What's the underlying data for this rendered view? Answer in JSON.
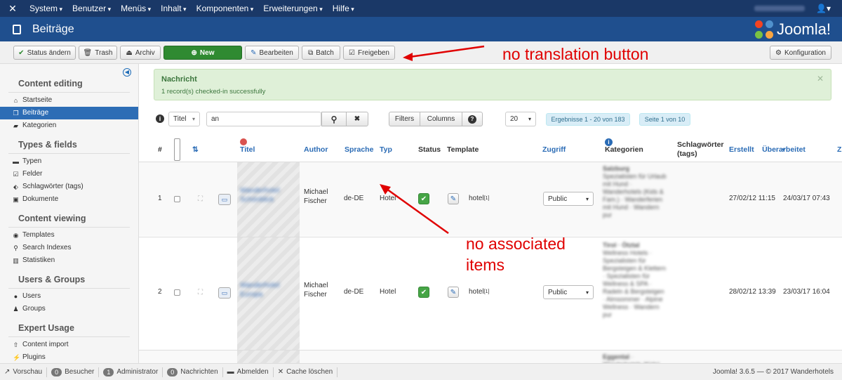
{
  "topnav": {
    "logo": "joomla-logo",
    "menus": [
      "System",
      "Benutzer",
      "Menüs",
      "Inhalt",
      "Komponenten",
      "Erweiterungen",
      "Hilfe"
    ]
  },
  "header": {
    "title": "Beiträge",
    "brand": "Joomla!"
  },
  "toolbar": {
    "status_aendern": "Status ändern",
    "trash": "Trash",
    "archiv": "Archiv",
    "new": "New",
    "bearbeiten": "Bearbeiten",
    "batch": "Batch",
    "freigeben": "Freigeben",
    "konfiguration": "Konfiguration"
  },
  "annotations": {
    "no_translation": "no translation button",
    "no_associated_1": "no associated",
    "no_associated_2": "items",
    "ghost": "no associated items",
    "color": "#e00000"
  },
  "sidebar": {
    "sections": [
      {
        "title": "Content editing",
        "items": [
          {
            "label": "Startseite",
            "icon": "home-icon"
          },
          {
            "label": "Beiträge",
            "icon": "copy-icon",
            "active": true
          },
          {
            "label": "Kategorien",
            "icon": "folder-icon"
          }
        ]
      },
      {
        "title": "Types & fields",
        "items": [
          {
            "label": "Typen",
            "icon": "briefcase-icon"
          },
          {
            "label": "Felder",
            "icon": "checkbox-icon"
          },
          {
            "label": "Schlagwörter (tags)",
            "icon": "tag-icon"
          },
          {
            "label": "Dokumente",
            "icon": "image-icon"
          }
        ]
      },
      {
        "title": "Content viewing",
        "items": [
          {
            "label": "Templates",
            "icon": "eye-icon"
          },
          {
            "label": "Search Indexes",
            "icon": "search-icon"
          },
          {
            "label": "Statistiken",
            "icon": "chart-icon"
          }
        ]
      },
      {
        "title": "Users & Groups",
        "items": [
          {
            "label": "Users",
            "icon": "user-icon"
          },
          {
            "label": "Groups",
            "icon": "users-icon"
          }
        ]
      },
      {
        "title": "Expert Usage",
        "items": [
          {
            "label": "Content import",
            "icon": "upload-icon"
          },
          {
            "label": "Plugins",
            "icon": "plug-icon"
          }
        ]
      }
    ]
  },
  "alert": {
    "heading": "Nachricht",
    "message": "1 record(s) checked-in successfully"
  },
  "filters": {
    "search_field": "Titel",
    "search_value": "an",
    "filters_btn": "Filters",
    "columns_btn": "Columns",
    "limit": "20",
    "results": "Ergebnisse 1 - 20 von 183",
    "page": "Seite 1 von 10"
  },
  "table": {
    "headers": {
      "num": "#",
      "title": "Titel",
      "author": "Author",
      "language": "Sprache",
      "type": "Typ",
      "status": "Status",
      "template": "Template",
      "access": "Zugriff",
      "categories": "Kategorien",
      "tags": "Schlagwörter (tags)",
      "created": "Erstellt",
      "modified": "Überarbeitet",
      "next": "Z"
    },
    "rows": [
      {
        "num": "1",
        "author": "Michael Fischer",
        "language": "de-DE",
        "type": "Hotel",
        "template": "hotel",
        "template_sup": "[1]",
        "access": "Public",
        "created": "27/02/12 11:15",
        "modified": "24/03/17 07:43"
      },
      {
        "num": "2",
        "author": "Michael Fischer",
        "language": "de-DE",
        "type": "Hotel",
        "template": "hotel",
        "template_sup": "[1]",
        "access": "Public",
        "created": "28/02/12 13:39",
        "modified": "23/03/17 16:04"
      }
    ]
  },
  "statusbar": {
    "vorschau": "Vorschau",
    "besucher_count": "0",
    "besucher": "Besucher",
    "admin_count": "1",
    "admin": "Administrator",
    "nachrichten_count": "0",
    "nachrichten": "Nachrichten",
    "abmelden": "Abmelden",
    "cache": "Cache löschen",
    "copyright": "Joomla! 3.6.5 — © 2017 Wanderhotels"
  }
}
